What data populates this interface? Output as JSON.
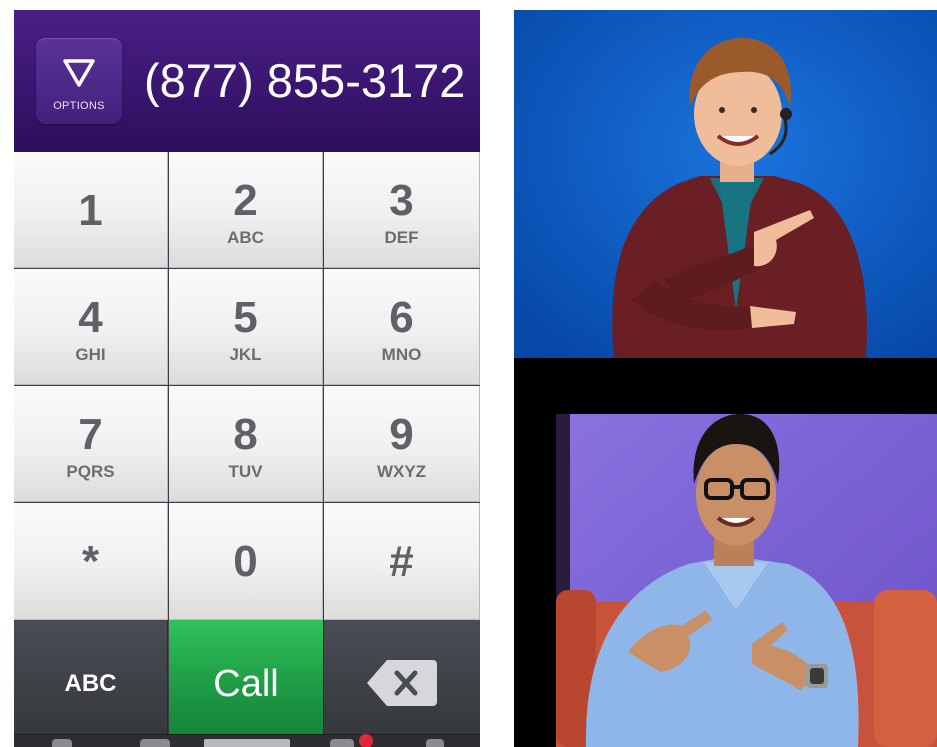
{
  "dialer": {
    "options_label": "OPTIONS",
    "phone_number": "(877) 855-3172",
    "keys": [
      {
        "digit": "1",
        "letters": ""
      },
      {
        "digit": "2",
        "letters": "ABC"
      },
      {
        "digit": "3",
        "letters": "DEF"
      },
      {
        "digit": "4",
        "letters": "GHI"
      },
      {
        "digit": "5",
        "letters": "JKL"
      },
      {
        "digit": "6",
        "letters": "MNO"
      },
      {
        "digit": "7",
        "letters": "PQRS"
      },
      {
        "digit": "8",
        "letters": "TUV"
      },
      {
        "digit": "9",
        "letters": "WXYZ"
      },
      {
        "digit": "*",
        "letters": ""
      },
      {
        "digit": "0",
        "letters": ""
      },
      {
        "digit": "#",
        "letters": ""
      }
    ],
    "abc_label": "ABC",
    "call_label": "Call",
    "backspace_icon": "backspace-icon"
  },
  "colors": {
    "header_purple": "#3a1670",
    "call_green": "#1e9a44",
    "key_text": "#5f6166"
  },
  "video": {
    "top_background": "#0a5ac8",
    "bottom_background": "#7a5fd0"
  }
}
